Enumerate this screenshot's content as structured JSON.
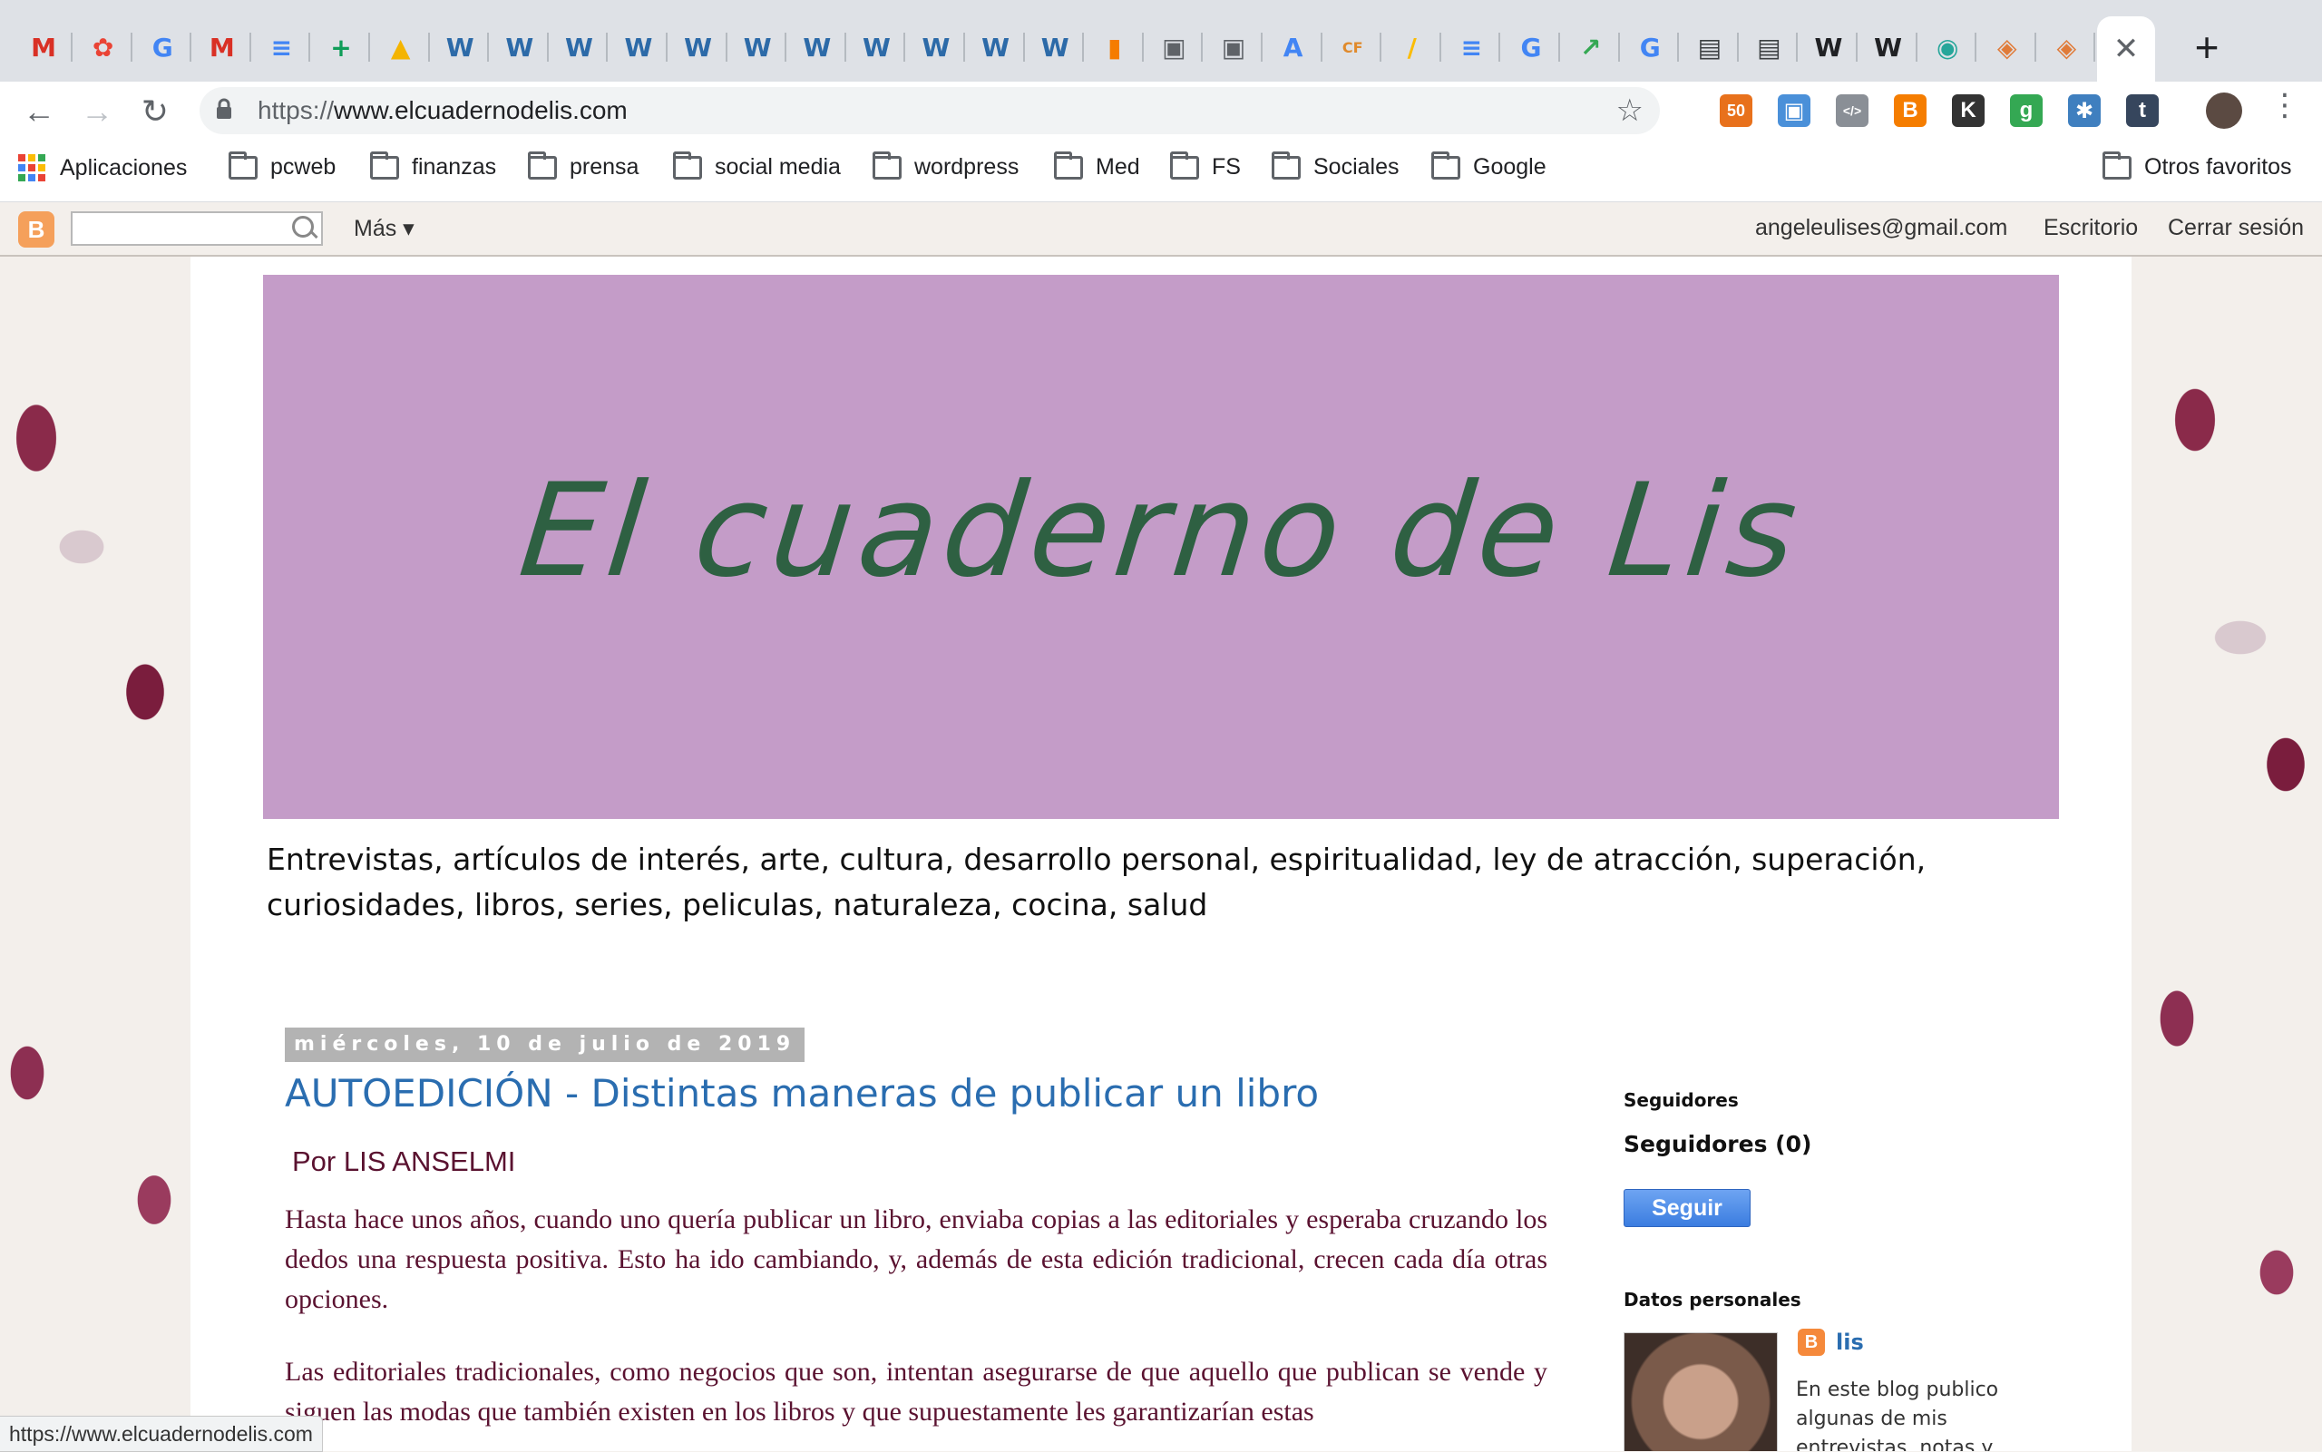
{
  "tabs": [
    {
      "icon": "gmail-icon",
      "glyph": "M",
      "color": "#d93025"
    },
    {
      "icon": "photos-icon",
      "glyph": "✿",
      "color": "#ea4335"
    },
    {
      "icon": "google-icon",
      "glyph": "G",
      "color": "#4285f4"
    },
    {
      "icon": "gmail-icon",
      "glyph": "M",
      "color": "#d93025"
    },
    {
      "icon": "docs-icon",
      "glyph": "≡",
      "color": "#4285f4"
    },
    {
      "icon": "sheets-icon",
      "glyph": "+",
      "color": "#0f9d58"
    },
    {
      "icon": "drive-icon",
      "glyph": "▲",
      "color": "#f4b400"
    },
    {
      "icon": "wordpress-icon",
      "glyph": "W",
      "color": "#2c6aa8"
    },
    {
      "icon": "wordpress-icon",
      "glyph": "W",
      "color": "#2c6aa8"
    },
    {
      "icon": "wordpress-icon",
      "glyph": "W",
      "color": "#2c6aa8"
    },
    {
      "icon": "wordpress-icon",
      "glyph": "W",
      "color": "#2c6aa8"
    },
    {
      "icon": "wordpress-icon",
      "glyph": "W",
      "color": "#2c6aa8"
    },
    {
      "icon": "wordpress-icon",
      "glyph": "W",
      "color": "#2c6aa8"
    },
    {
      "icon": "wordpress-icon",
      "glyph": "W",
      "color": "#2c6aa8"
    },
    {
      "icon": "wordpress-icon",
      "glyph": "W",
      "color": "#2c6aa8"
    },
    {
      "icon": "wordpress-icon",
      "glyph": "W",
      "color": "#2c6aa8"
    },
    {
      "icon": "wordpress-icon",
      "glyph": "W",
      "color": "#2c6aa8"
    },
    {
      "icon": "wordpress-icon",
      "glyph": "W",
      "color": "#2c6aa8"
    },
    {
      "icon": "analytics-icon",
      "glyph": "▮",
      "color": "#f57c00"
    },
    {
      "icon": "clipboard-icon",
      "glyph": "▣",
      "color": "#5f6368"
    },
    {
      "icon": "clipboard-icon",
      "glyph": "▣",
      "color": "#5f6368"
    },
    {
      "icon": "ads-icon",
      "glyph": "A",
      "color": "#4285f4"
    },
    {
      "icon": "cf-icon",
      "glyph": "CF",
      "color": "#e08a2c"
    },
    {
      "icon": "adsense-icon",
      "glyph": "/",
      "color": "#fbbc04"
    },
    {
      "icon": "docs-icon",
      "glyph": "≡",
      "color": "#4285f4"
    },
    {
      "icon": "google-icon",
      "glyph": "G",
      "color": "#4285f4"
    },
    {
      "icon": "trends-icon",
      "glyph": "↗",
      "color": "#34a853"
    },
    {
      "icon": "google-icon",
      "glyph": "G",
      "color": "#4285f4"
    },
    {
      "icon": "book-icon",
      "glyph": "▤",
      "color": "#3c4043"
    },
    {
      "icon": "book-icon",
      "glyph": "▤",
      "color": "#3c4043"
    },
    {
      "icon": "wikipedia-icon",
      "glyph": "W",
      "color": "#202124"
    },
    {
      "icon": "wikipedia-icon",
      "glyph": "W",
      "color": "#202124"
    },
    {
      "icon": "eye-icon",
      "glyph": "◉",
      "color": "#26a69a"
    },
    {
      "icon": "layers-icon",
      "glyph": "◈",
      "color": "#e07b39"
    },
    {
      "icon": "layers-icon",
      "glyph": "◈",
      "color": "#e07b39"
    }
  ],
  "active_tab": {
    "close": "✕"
  },
  "new_tab": "+",
  "toolbar": {
    "back": "←",
    "forward": "→",
    "reload": "↻",
    "url_scheme": "https://",
    "url_host": "www.elcuadernodelis.com",
    "star": "☆",
    "menu": "⋮"
  },
  "extensions": [
    {
      "icon": "seo-quake-icon",
      "glyph": "50",
      "color": "#e8711c"
    },
    {
      "icon": "screen-capture-icon",
      "glyph": "▣",
      "color": "#4a90d9"
    },
    {
      "icon": "html-icon",
      "glyph": "</>",
      "color": "#8a8f96"
    },
    {
      "icon": "blogger-icon",
      "glyph": "B",
      "color": "#f57d00"
    },
    {
      "icon": "k-icon",
      "glyph": "K",
      "color": "#333333"
    },
    {
      "icon": "google-plus-icon",
      "glyph": "g",
      "color": "#34a853"
    },
    {
      "icon": "network-icon",
      "glyph": "✱",
      "color": "#3f7fbf"
    },
    {
      "icon": "tumblr-icon",
      "glyph": "t",
      "color": "#36465d"
    }
  ],
  "bookmarks": {
    "apps": "Aplicaciones",
    "folders": [
      "pcweb",
      "finanzas",
      "prensa",
      "social media",
      "wordpress",
      "Med",
      "FS",
      "Sociales",
      "Google"
    ],
    "other": "Otros favoritos"
  },
  "navbar": {
    "more": "Más",
    "email": "angeleulises@gmail.com",
    "desk": "Escritorio",
    "logout": "Cerrar sesión"
  },
  "blog": {
    "title": "El cuaderno de Lis",
    "description": "Entrevistas, artículos de interés, arte, cultura, desarrollo personal, espiritualidad, ley de atracción, superación, curiosidades, libros, series, peliculas, naturaleza, cocina, salud"
  },
  "post": {
    "date": "miércoles, 10 de julio de 2019",
    "title": "AUTOEDICIÓN - Distintas maneras de publicar un libro",
    "byline": "Por LIS ANSELMI",
    "p1": "Hasta hace unos años, cuando uno quería publicar un libro, enviaba copias a las editoriales y esperaba cruzando los dedos una respuesta positiva. Esto ha ido cambiando, y, además de esta edición tradicional, crecen cada día otras opciones.",
    "p2": "Las editoriales tradicionales, como negocios que son, intentan asegurarse de que aquello que publican se vende y siguen las modas que también existen en los libros y que supuestamente les garantizarían estas"
  },
  "sidebar": {
    "followers_heading": "Seguidores",
    "followers_count": "Seguidores (0)",
    "follow_button": "Seguir",
    "profile_heading": "Datos personales",
    "profile_name": "lis",
    "about": "En este blog publico algunas de mis entrevistas, notas y artículos escritos para otros medios o"
  },
  "status_url": "https://www.elcuadernodelis.com"
}
